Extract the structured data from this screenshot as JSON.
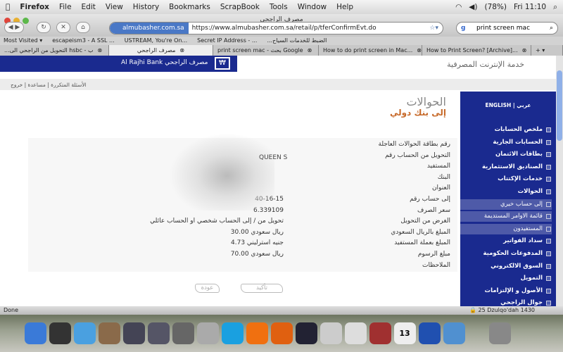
{
  "menubar": {
    "app": "Firefox",
    "items": [
      "File",
      "Edit",
      "View",
      "History",
      "Bookmarks",
      "ScrapBook",
      "Tools",
      "Window",
      "Help"
    ],
    "battery": "(78%)",
    "clock": "Fri 11:10"
  },
  "window": {
    "title": "مصرف الراجحي"
  },
  "toolbar": {
    "site_badge": "almubasher.com.sa",
    "url": "https://www.almubasher.com.sa/retail/p/tferConfirmEvt.do",
    "search": "print screen mac"
  },
  "bookmarks": [
    "Most Visited ▾",
    "escapeism3 - A SSL ...",
    "USTREAM, You're On...",
    "Secret IP Address - ...",
    "...الضبط للخدمات السياح"
  ],
  "tabs": [
    {
      "label": "...التحويل من الراجحي الى hsbc - ب"
    },
    {
      "label": "مصرف الراجحي",
      "active": true
    },
    {
      "label": "print screen mac - بحث Google"
    },
    {
      "label": "How to do print screen in Mac..."
    },
    {
      "label": "How to Print Screen? [Archive]..."
    }
  ],
  "header": {
    "bank_name": "Al Rajhi Bank مصرف الراجحي",
    "service": "خدمة الإنترنت المصرفية",
    "links": "الأسئلة المتكررة | مساعدة | خروج"
  },
  "sidebar": {
    "lang": "ENGLISH | عربي",
    "items": [
      {
        "label": "ملخص الحسابات"
      },
      {
        "label": "الحسابات الجارية"
      },
      {
        "label": "بطاقات الائتمان"
      },
      {
        "label": "الصناديق الاستثمارية"
      },
      {
        "label": "خدمات الإكتتاب"
      },
      {
        "label": "الحوالات"
      },
      {
        "label": "إلى حساب خيري",
        "sub": true
      },
      {
        "label": "قائمة الاوامر المستديمة",
        "sub": true
      },
      {
        "label": "المستفيدون",
        "sub": true
      },
      {
        "label": "سداد الفواتير"
      },
      {
        "label": "المدفوعات الحكومية"
      },
      {
        "label": "السوق الالكتروني"
      },
      {
        "label": "التمويل"
      },
      {
        "label": "الأصول و الإلتزامات"
      },
      {
        "label": "جوال الراجحي"
      }
    ]
  },
  "main": {
    "title": "الحوالات",
    "subtitle": "إلى بنك دولي",
    "rows": [
      {
        "label": "رقم بطاقة الحوالات العاجلة",
        "value": ""
      },
      {
        "label": "التحويل من الحساب رقم",
        "value": ""
      },
      {
        "label": "المستفيد",
        "value": ""
      },
      {
        "label": "البنك",
        "value": ""
      },
      {
        "label": "العنوان",
        "value": ""
      },
      {
        "label": "إلى حساب رقم",
        "value": "40-16-15"
      },
      {
        "label": "سعر الصرف",
        "value": "6.339109"
      },
      {
        "label": "الغرض من التحويل",
        "value": "تحويل من / إلى الحساب شخصي او الحساب عائلي"
      },
      {
        "label": "المبلغ بالريال السعودي",
        "value": "30.00  ريال سعودي"
      },
      {
        "label": "المبلغ بعملة المستفيد",
        "value": "4.73  جنيه استرليني"
      },
      {
        "label": "مبلغ الرسوم",
        "value": "70.00  ريال سعودي"
      },
      {
        "label": "الملاحظات",
        "value": ""
      }
    ],
    "overlay_text": "QUEEN S",
    "confirm": "تأكيد",
    "back": "عودة"
  },
  "status": {
    "left": "Done",
    "date": "25 Dzulqo'dah 1430"
  },
  "dock": [
    "finder",
    "dashboard",
    "safari",
    "iphoto",
    "spaces",
    "time-machine",
    "system-preferences",
    "calculator",
    "skype",
    "vlc",
    "firefox",
    "activity-monitor",
    "script-editor",
    "picasa",
    "dictionary",
    "ical",
    "google-earth",
    "itunes",
    "trash"
  ],
  "dock_ical_day": "13",
  "colors": {
    "sidebar": "#1a2a8f",
    "subtitle": "#c76a2a"
  }
}
